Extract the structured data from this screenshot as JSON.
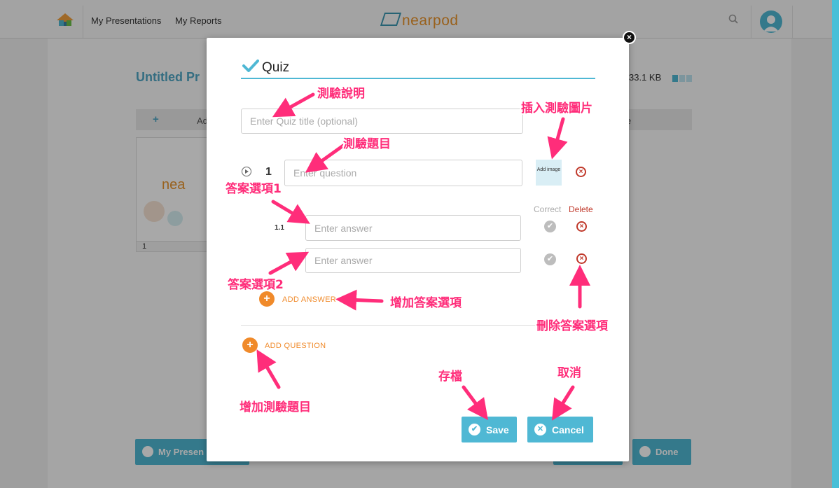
{
  "topbar": {
    "nav": [
      "My Presentations",
      "My Reports"
    ],
    "logo": "nearpod",
    "icons": [
      "home-icon",
      "search-icon",
      "avatar-icon"
    ]
  },
  "background": {
    "title": "Untitled Pr",
    "size_text": "33.1 KB",
    "bar_left": "Ad",
    "bar_right": "e",
    "thumb_logo": "nea",
    "slide_number": "1",
    "btn_my_presentations": "My Presen",
    "btn_done": "Done"
  },
  "modal": {
    "title": "Quiz",
    "quiz_title_placeholder": "Enter Quiz title (optional)",
    "question_number": "1",
    "question_placeholder": "Enter question",
    "add_image_label": "Add image",
    "correct_header": "Correct",
    "delete_header": "Delete",
    "answers": [
      {
        "num": "1.1",
        "placeholder": "Enter answer"
      },
      {
        "num": "",
        "placeholder": "Enter answer"
      }
    ],
    "add_answer_label": "ADD ANSWER",
    "add_question_label": "ADD QUESTION",
    "save_label": "Save",
    "cancel_label": "Cancel",
    "accent_color": "#4fb8d4",
    "orange_color": "#f08a2a",
    "delete_color": "#c0392b"
  },
  "annotations": {
    "quiz_description": "測驗說明",
    "insert_quiz_image": "插入測驗圖片",
    "quiz_question": "測驗題目",
    "answer_option_1": "答案選項1",
    "answer_option_2": "答案選項2",
    "add_answer_option": "增加答案選項",
    "delete_answer_option": "刪除答案選項",
    "add_quiz_question": "增加測驗題目",
    "save": "存檔",
    "cancel": "取消",
    "color": "#ff2d7a"
  }
}
